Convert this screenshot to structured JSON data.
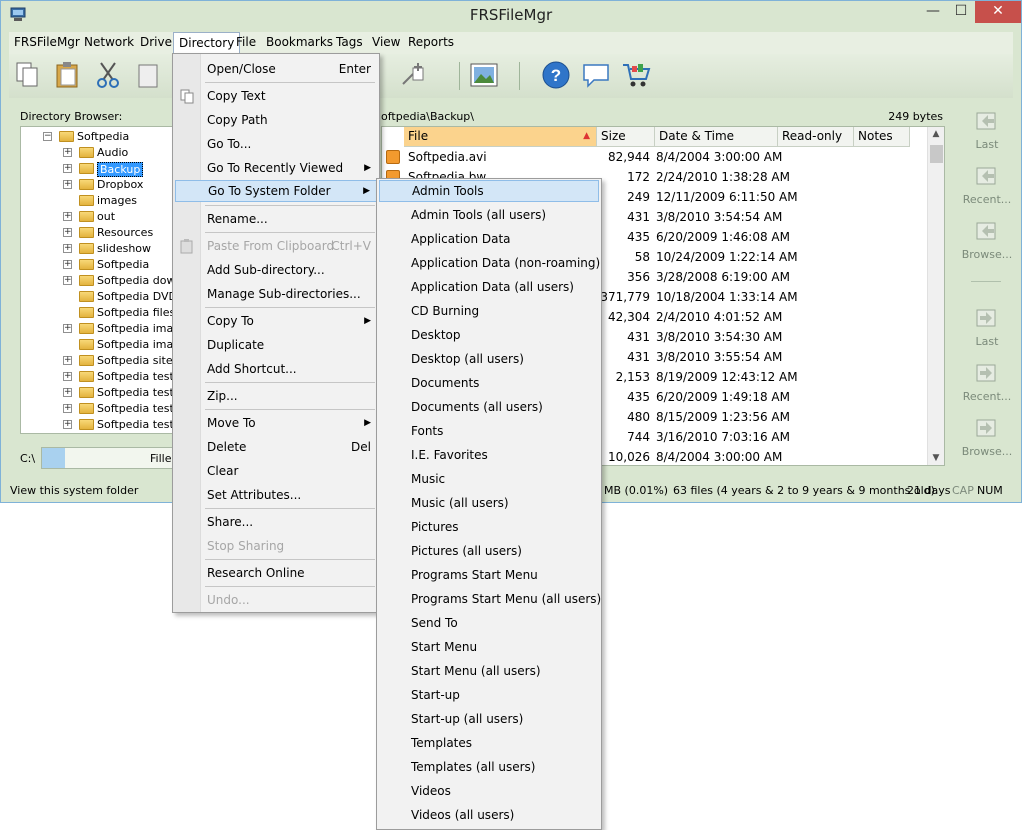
{
  "window": {
    "title": "FRSFileMgr",
    "close_label": "✕",
    "min_label": "—",
    "max_label": "☐"
  },
  "menubar": [
    "FRSFileMgr",
    "Network",
    "Drive",
    "Directory",
    "File",
    "Bookmarks",
    "Tags",
    "View",
    "Reports"
  ],
  "directory_browser": {
    "label": "Directory Browser:",
    "items": [
      {
        "label": "Softpedia",
        "expanded": true
      },
      {
        "label": "Audio"
      },
      {
        "label": "Backup",
        "selected": true
      },
      {
        "label": "Dropbox"
      },
      {
        "label": "images"
      },
      {
        "label": "out"
      },
      {
        "label": "Resources"
      },
      {
        "label": "slideshow"
      },
      {
        "label": "Softpedia"
      },
      {
        "label": "Softpedia down"
      },
      {
        "label": "Softpedia DVD"
      },
      {
        "label": "Softpedia files"
      },
      {
        "label": "Softpedia image"
      },
      {
        "label": "Softpedia image"
      },
      {
        "label": "Softpedia sitema"
      },
      {
        "label": "Softpedia test a"
      },
      {
        "label": "Softpedia test c"
      },
      {
        "label": "Softpedia test m"
      },
      {
        "label": "Softpedia testec"
      }
    ]
  },
  "drive": {
    "label": "C:\\",
    "bar_text": "Filled",
    "fill_fraction": 0.17
  },
  "file_list": {
    "path": "oftpedia\\Backup\\",
    "bytes": "249 bytes",
    "columns": [
      "File",
      "Size",
      "Date & Time",
      "Read-only",
      "Notes"
    ],
    "rows": [
      {
        "file": "Softpedia.avi",
        "size": "82,944",
        "date": "8/4/2004 3:00:00 AM"
      },
      {
        "file": "Softpedia.bw",
        "size": "172",
        "date": "2/24/2010 1:38:28 AM"
      },
      {
        "file": "",
        "size": "249",
        "date": "12/11/2009 6:11:50 AM"
      },
      {
        "file": "",
        "size": "431",
        "date": "3/8/2010 3:54:54 AM"
      },
      {
        "file": "",
        "size": "435",
        "date": "6/20/2009 1:46:08 AM"
      },
      {
        "file": "",
        "size": "58",
        "date": "10/24/2009 1:22:14 AM"
      },
      {
        "file": "",
        "size": "356",
        "date": "3/28/2008 6:19:00 AM"
      },
      {
        "file": "",
        "size": "371,779",
        "date": "10/18/2004 1:33:14 AM"
      },
      {
        "file": "",
        "size": "42,304",
        "date": "2/4/2010 4:01:52 AM"
      },
      {
        "file": "",
        "size": "431",
        "date": "3/8/2010 3:54:30 AM"
      },
      {
        "file": "",
        "size": "431",
        "date": "3/8/2010 3:55:54 AM"
      },
      {
        "file": "",
        "size": "2,153",
        "date": "8/19/2009 12:43:12 AM"
      },
      {
        "file": "",
        "size": "435",
        "date": "6/20/2009 1:49:18 AM"
      },
      {
        "file": "",
        "size": "480",
        "date": "8/15/2009 1:23:56 AM"
      },
      {
        "file": "",
        "size": "744",
        "date": "3/16/2010 7:03:16 AM"
      },
      {
        "file": "",
        "size": "10,026",
        "date": "8/4/2004 3:00:00 AM"
      }
    ]
  },
  "nav": {
    "last": "Last",
    "recent": "Recent...",
    "browse": "Browse..."
  },
  "status": {
    "hint": "View this system folder",
    "usage": "MB (0.01%)",
    "summary": "63 files (4 years & 2 to 9 years & 9 months old)",
    "days": "21 days",
    "cap": "CAP",
    "num": "NUM"
  },
  "directory_menu": {
    "open_close": "Open/Close",
    "open_close_shortcut": "Enter",
    "copy_text": "Copy Text",
    "copy_path": "Copy Path",
    "go_to": "Go To...",
    "go_to_recent": "Go To Recently Viewed",
    "go_to_system": "Go To System Folder",
    "rename": "Rename...",
    "paste_clipboard": "Paste From Clipboard",
    "paste_shortcut": "Ctrl+V",
    "add_subdir": "Add Sub-directory...",
    "manage_subdirs": "Manage Sub-directories...",
    "copy_to": "Copy To",
    "duplicate": "Duplicate",
    "add_shortcut": "Add Shortcut...",
    "zip": "Zip...",
    "move_to": "Move To",
    "delete": "Delete",
    "delete_shortcut": "Del",
    "clear": "Clear",
    "set_attributes": "Set Attributes...",
    "share": "Share...",
    "stop_sharing": "Stop Sharing",
    "research_online": "Research Online",
    "undo": "Undo..."
  },
  "system_folder_menu": [
    "Admin Tools",
    "Admin Tools (all users)",
    "Application Data",
    "Application Data (non-roaming)",
    "Application Data (all users)",
    "CD Burning",
    "Desktop",
    "Desktop (all users)",
    "Documents",
    "Documents (all users)",
    "Fonts",
    "I.E. Favorites",
    "Music",
    "Music (all users)",
    "Pictures",
    "Pictures (all users)",
    "Programs Start Menu",
    "Programs Start Menu (all users)",
    "Send To",
    "Start Menu",
    "Start Menu (all users)",
    "Start-up",
    "Start-up (all users)",
    "Templates",
    "Templates (all users)",
    "Videos",
    "Videos (all users)"
  ]
}
